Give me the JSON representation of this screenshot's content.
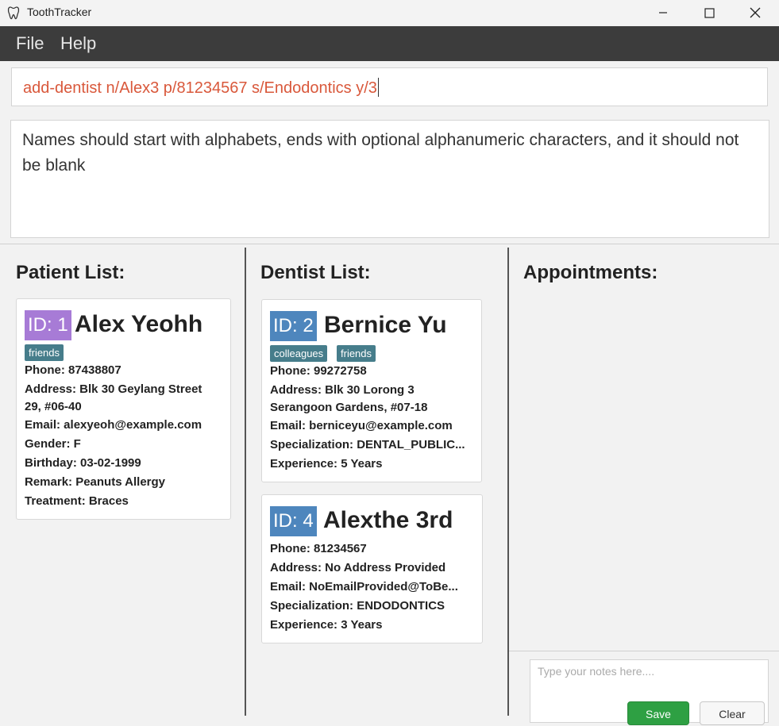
{
  "window": {
    "title": "ToothTracker"
  },
  "menu": {
    "file": "File",
    "help": "Help"
  },
  "command": {
    "value": "add-dentist n/Alex3 p/81234567 s/Endodontics y/3"
  },
  "result": {
    "message": "Names should start with alphabets, ends with optional alphanumeric characters, and it should not be blank"
  },
  "patients": {
    "title": "Patient List:",
    "items": [
      {
        "id_label": "ID: 1",
        "name": "Alex Yeohh",
        "tags": [
          "friends"
        ],
        "phone": "Phone: 87438807",
        "address": "Address: Blk 30 Geylang Street 29, #06-40",
        "email": "Email: alexyeoh@example.com",
        "gender": "Gender: F",
        "birthday": "Birthday: 03-02-1999",
        "remark": "Remark: Peanuts Allergy",
        "treatment": "Treatment: Braces"
      }
    ]
  },
  "dentists": {
    "title": "Dentist List:",
    "items": [
      {
        "id_label": "ID: 2",
        "name": "Bernice Yu",
        "tags": [
          "colleagues",
          "friends"
        ],
        "phone": "Phone: 99272758",
        "address": "Address: Blk 30 Lorong 3 Serangoon Gardens, #07-18",
        "email": "Email: berniceyu@example.com",
        "specialization": "Specialization: DENTAL_PUBLIC...",
        "experience": "Experience: 5 Years"
      },
      {
        "id_label": "ID: 4",
        "name": "Alexthe 3rd",
        "tags": [],
        "phone": "Phone: 81234567",
        "address": "Address: No Address Provided",
        "email": "Email: NoEmailProvided@ToBe...",
        "specialization": "Specialization: ENDODONTICS",
        "experience": "Experience: 3 Years"
      }
    ]
  },
  "appointments": {
    "title": "Appointments:",
    "notes_placeholder": "Type your notes here....",
    "save_label": "Save",
    "clear_label": "Clear"
  },
  "colors": {
    "menubar": "#3c3c3c",
    "command_text": "#d9583b",
    "patient_id_badge": "#a77bd6",
    "dentist_id_badge": "#4e86bd",
    "tag": "#467d8b",
    "save_button": "#2ea043"
  }
}
